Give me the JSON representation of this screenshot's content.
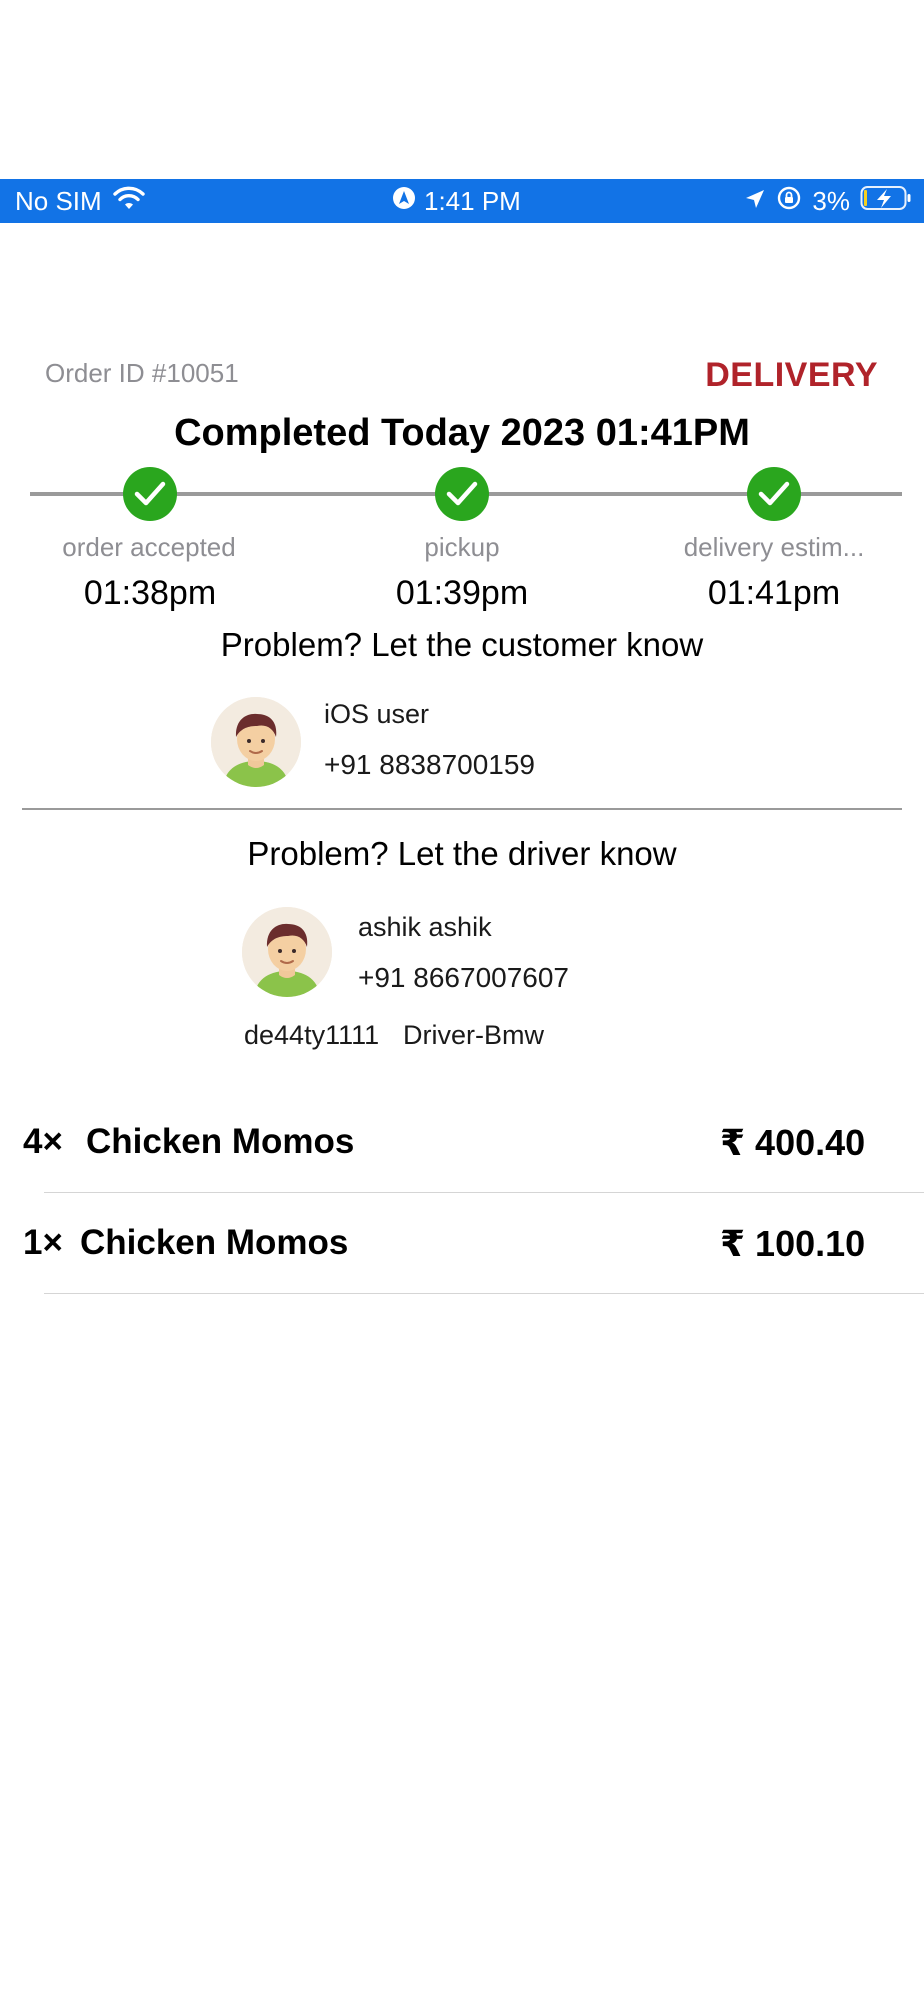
{
  "status_bar": {
    "carrier": "No SIM",
    "time": "1:41 PM",
    "battery": "3%"
  },
  "order": {
    "id_label": "Order ID #10051",
    "type": "DELIVERY",
    "completed_label": "Completed Today 2023 01:41PM"
  },
  "timeline": [
    {
      "label": "order accepted",
      "time": "01:38pm"
    },
    {
      "label": "pickup",
      "time": "01:39pm"
    },
    {
      "label": "delivery estim...",
      "time": "01:41pm"
    }
  ],
  "customer": {
    "heading": "Problem? Let the customer know",
    "name": "iOS user",
    "phone": "+91 8838700159"
  },
  "driver": {
    "heading": "Problem? Let the driver know",
    "name": "ashik ashik",
    "phone": "+91 8667007607",
    "vehicle_number": "de44ty1111",
    "vehicle_name": "Driver-Bmw"
  },
  "items": [
    {
      "qty": "4×",
      "name": "Chicken Momos",
      "price": "₹ 400.40"
    },
    {
      "qty": "1×",
      "name": "Chicken Momos",
      "price": "₹ 100.10"
    }
  ],
  "colors": {
    "status_bar": "#1273e6",
    "delivery": "#b0232a",
    "check": "#2aa61e"
  }
}
